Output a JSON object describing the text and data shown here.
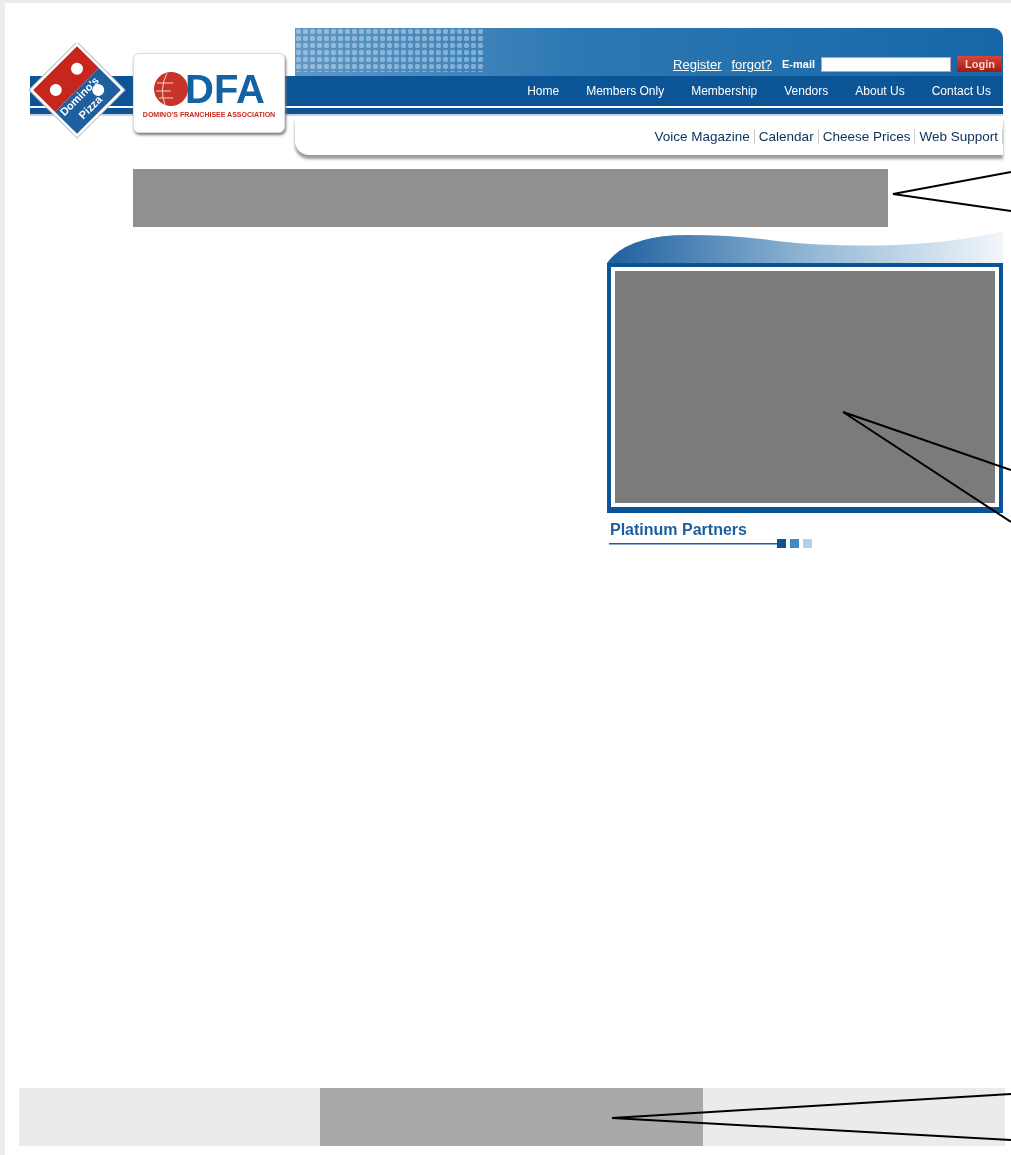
{
  "logos": {
    "pizza_logo": [
      "Domino's",
      "Pizza"
    ],
    "dfa": {
      "title": "DFA",
      "subtitle": "DOMINO'S FRANCHISEE ASSOCIATION"
    }
  },
  "account_bar": {
    "links": [
      "Register",
      "forgot?"
    ],
    "email_label": "E-mail",
    "login_button": "Login"
  },
  "main_nav": [
    "Home",
    "Members Only",
    "Membership",
    "Vendors",
    "About Us",
    "Contact Us"
  ],
  "sub_nav": [
    "Voice Magazine",
    "Calendar",
    "Cheese Prices",
    "Web Support"
  ],
  "partners": {
    "title": "Platinum Partners"
  }
}
